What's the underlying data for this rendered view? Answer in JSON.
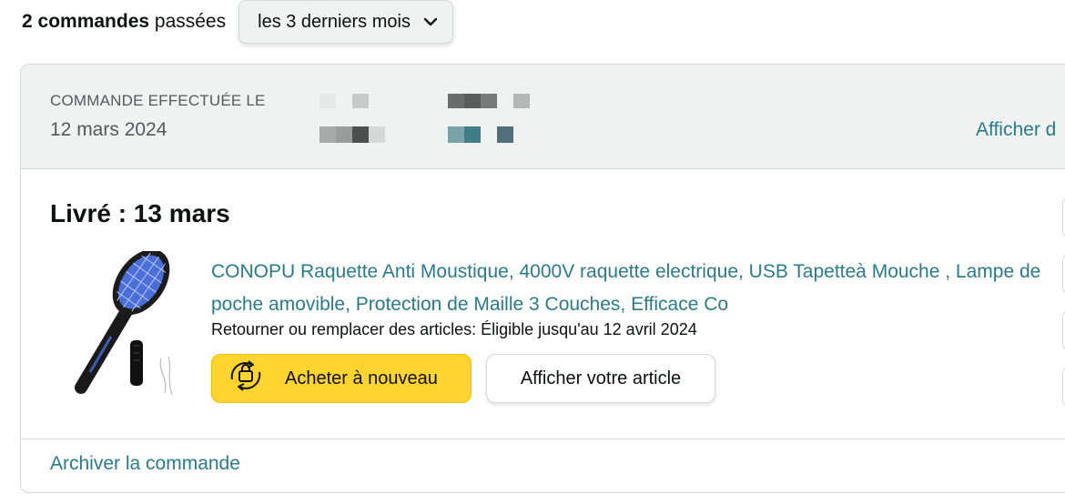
{
  "summary": {
    "count_bold": "2 commandes",
    "count_rest": " passées"
  },
  "filter": {
    "selected": "les 3 derniers mois",
    "icon": "chevron-down-icon"
  },
  "order": {
    "header": {
      "placed_label": "COMMANDE EFFECTUÉE LE",
      "placed_date": "12 mars 2024",
      "details_link": "Afficher d"
    },
    "status": "Livré : 13 mars",
    "item": {
      "title": "CONOPU Raquette Anti Moustique, 4000V raquette electrique, USB Tapetteà Mouche , Lampe de poche amovible, Protection de Maille 3 Couches, Efficace Co",
      "return_info": "Retourner ou remplacer des articles: Éligible jusqu'au 12 avril 2024",
      "image": "mosquito-racket-product-image"
    },
    "buttons": {
      "buy_again": "Acheter à nouveau",
      "view_item": "Afficher votre article"
    },
    "archive_link": "Archiver la commande"
  },
  "colors": {
    "link": "#2a7b8a",
    "buy_button": "#ffd42e",
    "header_bg": "#f0f2f2",
    "border": "#d5d9d9"
  }
}
